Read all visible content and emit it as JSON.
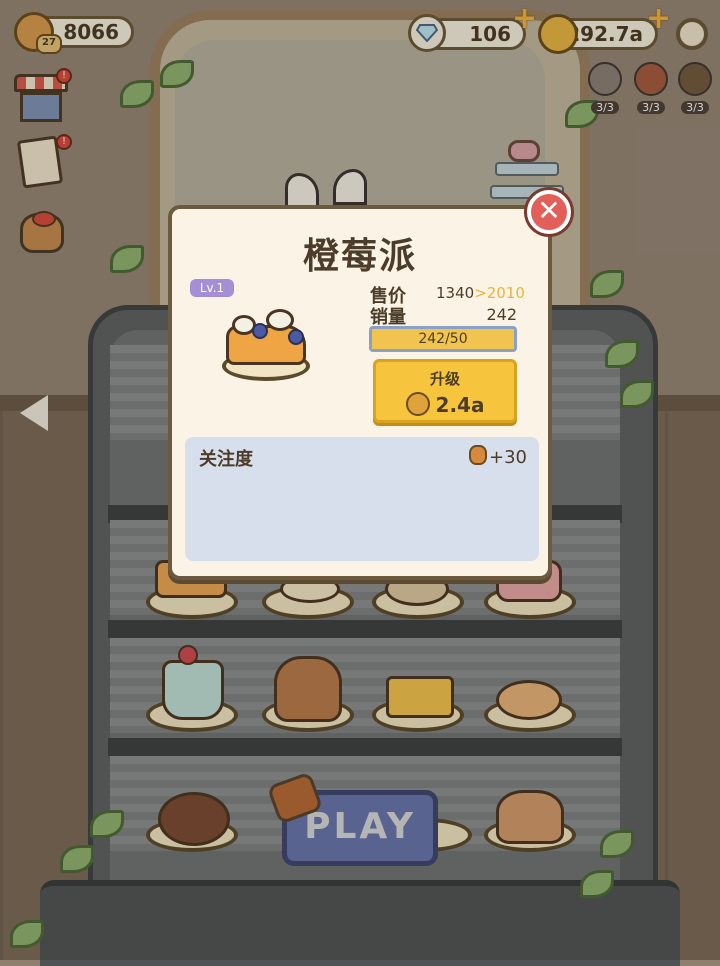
{
  "hud": {
    "bread_count": "8066",
    "player_level": "27",
    "diamonds": "106",
    "coins": "292.7a",
    "plus_symbol": "+",
    "helpers": [
      {
        "name": "helper-1",
        "count": "3/3"
      },
      {
        "name": "helper-2",
        "count": "3/3"
      },
      {
        "name": "helper-3",
        "count": "3/3"
      }
    ]
  },
  "side_menu": {
    "shop_badge": "!",
    "tasks_badge": "!"
  },
  "modal": {
    "title": "橙莓派",
    "level": "Lv.1",
    "price_label": "售价",
    "price_current": "1340",
    "price_arrow": ">",
    "price_next": "2010",
    "sales_label": "销量",
    "sales_value": "242",
    "progress_text": "242/50",
    "progress_fraction": 1.0,
    "upgrade_label": "升级",
    "upgrade_cost": "2.4a",
    "attention_label": "关注度",
    "attention_value": "+30",
    "close_symbol": "✕"
  },
  "play_button": "PLAY",
  "colors": {
    "accent_yellow": "#f6c53d",
    "price_next": "#e9b53a",
    "level_badge": "#a58ed6",
    "close_red": "#e3605a",
    "play_blue": "#6775ad"
  }
}
